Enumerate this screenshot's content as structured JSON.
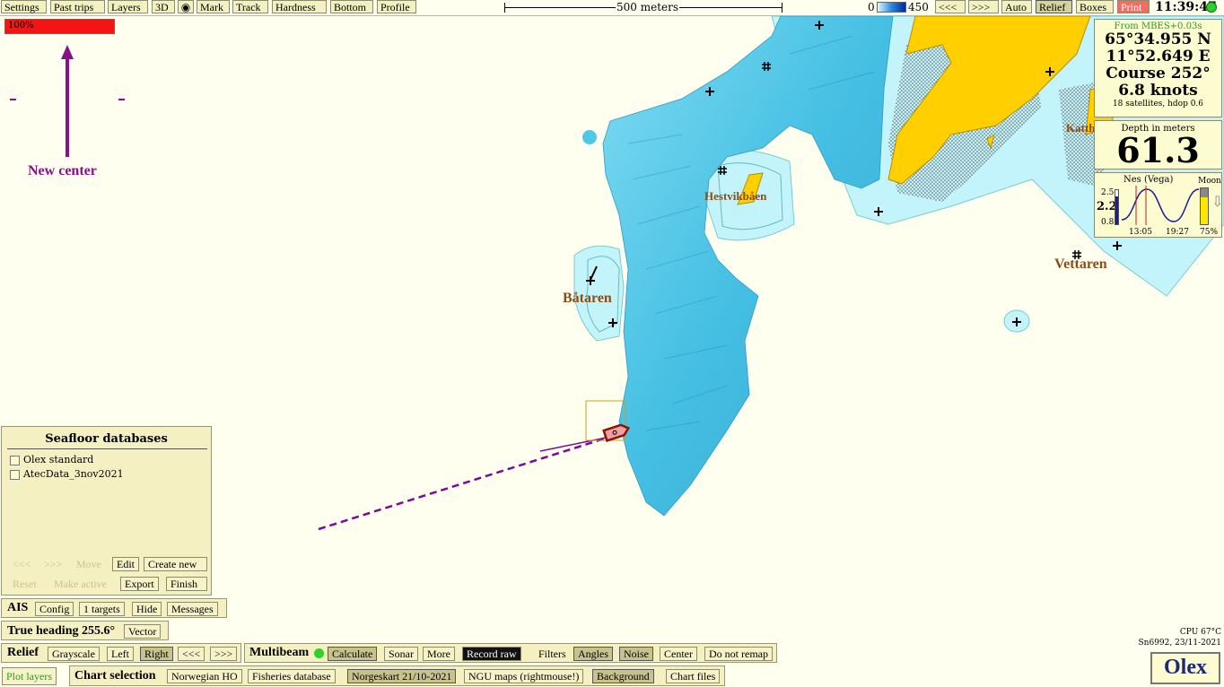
{
  "toolbar": {
    "settings": "Settings",
    "past_trips": "Past trips",
    "layers": "Layers",
    "three_d": "3D",
    "mark": "Mark",
    "track": "Track",
    "hardness": "Hardness",
    "bottom": "Bottom",
    "profile": "Profile",
    "scale_label": "500 meters",
    "depth_min": "0",
    "depth_max": "450",
    "prev": "<<<",
    "next": ">>>",
    "auto": "Auto",
    "relief": "Relief",
    "boxes": "Boxes",
    "print": "Print",
    "time": "11:39:47"
  },
  "overlay": {
    "progress_label": "100%",
    "progress_value": 1.0,
    "new_center": "New center"
  },
  "places": {
    "hestvikbaen": "Hestvikbåen",
    "bataren": "Båtaren",
    "vettaren": "Vettaren",
    "katth": "Katth"
  },
  "position": {
    "source": "From MBES+0.03s",
    "lat": "65°34.955 N",
    "lon": "11°52.649 E",
    "course": "Course 252°",
    "speed": "6.8 knots",
    "satellites": "18 satellites, hdop 0.6"
  },
  "depth": {
    "title": "Depth in meters",
    "value": "61.3"
  },
  "tide": {
    "station": "Nes (Vega)",
    "current": "2.2",
    "max": "2.5",
    "min": "0.8",
    "time1": "13:05",
    "time2": "19:27",
    "moon_label": "Moon",
    "moon_pct": "75%"
  },
  "seafloor": {
    "title": "Seafloor databases",
    "items": [
      "Olex standard",
      "AtecData_3nov2021"
    ],
    "prev": "<<<",
    "next": ">>>",
    "move": "Move",
    "edit": "Edit",
    "create_new": "Create new",
    "reset": "Reset",
    "make_active": "Make active",
    "export": "Export",
    "finish": "Finish"
  },
  "ais": {
    "label": "AIS",
    "config": "Config",
    "targets": "1 targets",
    "hide": "Hide",
    "messages": "Messages"
  },
  "heading": {
    "label": "True heading 255.6°",
    "vector": "Vector"
  },
  "relief": {
    "label": "Relief",
    "grayscale": "Grayscale",
    "left": "Left",
    "right": "Right",
    "prev": "<<<",
    "next": ">>>"
  },
  "multibeam": {
    "label": "Multibeam",
    "calculate": "Calculate",
    "sonar": "Sonar",
    "more": "More",
    "record_raw": "Record raw",
    "filters": "Filters",
    "angles": "Angles",
    "noise": "Noise",
    "center": "Center",
    "do_not_remap": "Do not remap"
  },
  "charts": {
    "plot_layers": "Plot layers",
    "label": "Chart selection",
    "norwegian_ho": "Norwegian HO",
    "fisheries": "Fisheries database",
    "norgeskart": "Norgeskart 21/10-2021",
    "ngu": "NGU maps (rightmouse!)",
    "background": "Background",
    "chart_files": "Chart files"
  },
  "status": {
    "cpu": "CPU 67°C",
    "serial": "Sn6992, 23/11-2021",
    "logo": "Olex"
  },
  "colors": {
    "land": "#ffcf00",
    "shallow": "#c4f4fb",
    "relief": "#4fc8e8",
    "track": "#7a0a9a",
    "vessel": "#a02010"
  }
}
